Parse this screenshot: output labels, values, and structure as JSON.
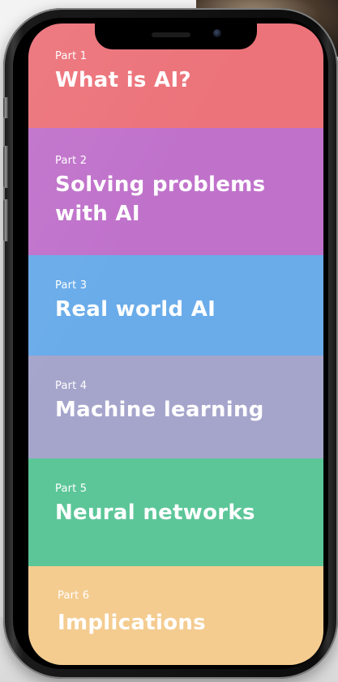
{
  "sections": [
    {
      "part": "Part 1",
      "title": "What is AI?",
      "color": "#ec737a"
    },
    {
      "part": "Part 2",
      "title": "Solving problems with AI",
      "color": "#c072cb"
    },
    {
      "part": "Part 3",
      "title": "Real world AI",
      "color": "#6aacea"
    },
    {
      "part": "Part 4",
      "title": "Machine learning",
      "color": "#a5a5cc"
    },
    {
      "part": "Part 5",
      "title": "Neural networks",
      "color": "#5cc698"
    },
    {
      "part": "Part 6",
      "title": "Implications",
      "color": "#f4cc90"
    }
  ]
}
